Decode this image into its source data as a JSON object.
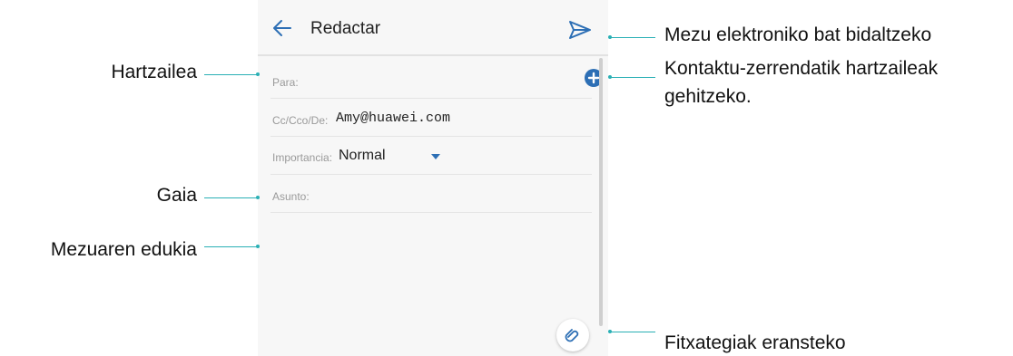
{
  "header": {
    "title": "Redactar",
    "back_icon": "back-arrow-icon",
    "send_icon": "send-icon"
  },
  "form": {
    "to_label": "Para:",
    "cc_label": "Cc/Cco/De:",
    "cc_value": "Amy@huawei.com",
    "importance_label": "Importancia:",
    "importance_value": "Normal",
    "subject_label": "Asunto:",
    "add_contact_icon": "plus-circle-icon",
    "attach_icon": "paperclip-icon"
  },
  "annotations": {
    "recipient": "Hartzailea",
    "subject": "Gaia",
    "body": "Mezuaren edukia",
    "send": "Mezu elektroniko bat bidaltzeko",
    "add_contacts_line1": "Kontaktu-zerrendatik hartzaileak",
    "add_contacts_line2": "gehitzeko.",
    "attach": "Fitxategiak eransteko"
  },
  "colors": {
    "accent": "#2d6fb5",
    "leader": "#2ab0b5",
    "screen_bg": "#f7f7f7"
  }
}
